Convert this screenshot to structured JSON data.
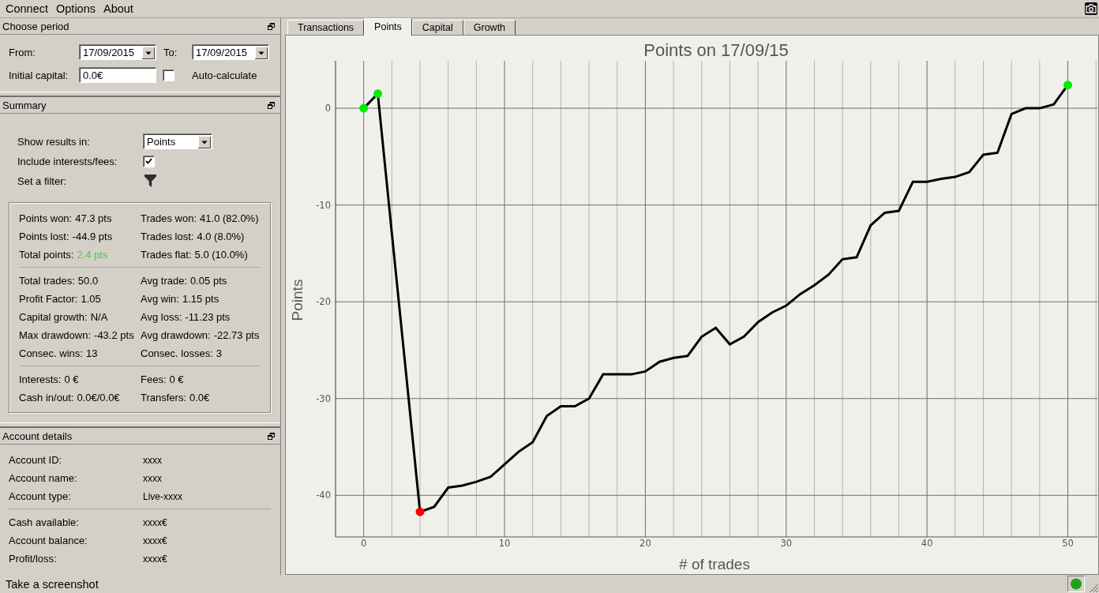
{
  "menu": [
    "Connect",
    "Options",
    "About"
  ],
  "choose_period": {
    "title": "Choose period",
    "from": {
      "label": "From:",
      "value": "17/09/2015"
    },
    "to": {
      "label": "To:",
      "value": "17/09/2015"
    },
    "initial_capital": {
      "label": "Initial capital:",
      "value": "0.0€"
    },
    "auto_calculate": {
      "label": "Auto-calculate",
      "checked": false
    }
  },
  "summary": {
    "title": "Summary",
    "show_results_in": {
      "label": "Show results in:",
      "value": "Points"
    },
    "include_interests_fees": {
      "label": "Include interests/fees:",
      "checked": true
    },
    "filter": {
      "label": "Set a filter:"
    },
    "stat_groups": [
      [
        {
          "label": "Points won:",
          "value": "47.3 pts"
        },
        {
          "label": "Trades won:",
          "value": "41.0 (82.0%)"
        },
        {
          "label": "Points lost:",
          "value": "-44.9 pts"
        },
        {
          "label": "Trades lost:",
          "value": "4.0 (8.0%)"
        },
        {
          "label": "Total points:",
          "value": "2.4 pts",
          "color": "#4ec94e"
        },
        {
          "label": "Trades flat:",
          "value": "5.0 (10.0%)"
        }
      ],
      [
        {
          "label": "Total trades:",
          "value": "50.0"
        },
        {
          "label": "Avg trade:",
          "value": "0.05 pts"
        },
        {
          "label": "Profit Factor:",
          "value": "1.05"
        },
        {
          "label": "Avg win:",
          "value": "1.15 pts"
        },
        {
          "label": "Capital growth:",
          "value": "N/A"
        },
        {
          "label": "Avg loss:",
          "value": "-11.23 pts"
        },
        {
          "label": "Max drawdown:",
          "value": "-43.2 pts"
        },
        {
          "label": "Avg drawdown:",
          "value": "-22.73 pts"
        },
        {
          "label": "Consec. wins:",
          "value": "13"
        },
        {
          "label": "Consec. losses:",
          "value": "3"
        }
      ],
      [
        {
          "label": "Interests:",
          "value": "0 €"
        },
        {
          "label": "Fees:",
          "value": "0 €"
        },
        {
          "label": "Cash in/out:",
          "value": "0.0€/0.0€"
        },
        {
          "label": "Transfers:",
          "value": "0.0€"
        }
      ]
    ]
  },
  "account_details": {
    "title": "Account details",
    "groups": [
      [
        {
          "label": "Account ID:",
          "value": "xxxx"
        },
        {
          "label": "Account name:",
          "value": "xxxx"
        },
        {
          "label": "Account type:",
          "value": "Live-xxxx"
        }
      ],
      [
        {
          "label": "Cash available:",
          "value": "xxxx€"
        },
        {
          "label": "Account balance:",
          "value": "xxxx€"
        },
        {
          "label": "Profit/loss:",
          "value": "xxxx€"
        }
      ]
    ]
  },
  "tabs": [
    {
      "label": "Transactions",
      "selected": false
    },
    {
      "label": "Points",
      "selected": true
    },
    {
      "label": "Capital",
      "selected": false
    },
    {
      "label": "Growth",
      "selected": false
    }
  ],
  "chart_panel": {
    "chart_data": {
      "type": "line",
      "title": "Points on 17/09/15",
      "xlabel": "# of trades",
      "ylabel": "Points",
      "x": [
        0,
        1,
        2,
        3,
        4,
        5,
        6,
        7,
        8,
        9,
        10,
        11,
        12,
        13,
        14,
        15,
        16,
        17,
        18,
        19,
        20,
        21,
        22,
        23,
        24,
        25,
        26,
        27,
        28,
        29,
        30,
        31,
        32,
        33,
        34,
        35,
        36,
        37,
        38,
        39,
        40,
        41,
        42,
        43,
        44,
        45,
        46,
        47,
        48,
        49,
        50
      ],
      "series": [
        {
          "color": "#000000",
          "values": [
            0,
            1.5,
            -12.9,
            -27.3,
            -41.7,
            -41.2,
            -39.2,
            -39.0,
            -38.6,
            -38.1,
            -36.8,
            -35.5,
            -34.5,
            -31.8,
            -30.8,
            -30.8,
            -30.0,
            -27.5,
            -27.5,
            -27.5,
            -27.2,
            -26.2,
            -25.8,
            -25.6,
            -23.6,
            -22.7,
            -24.4,
            -23.6,
            -22.1,
            -21.1,
            -20.4,
            -19.2,
            -18.3,
            -17.2,
            -15.6,
            -15.4,
            -12.1,
            -10.8,
            -10.6,
            -7.6,
            -7.6,
            -7.3,
            -7.1,
            -6.6,
            -4.8,
            -4.6,
            -0.6,
            0,
            0,
            0.4,
            2.4
          ]
        }
      ],
      "xlim": [
        -2,
        52.1
      ],
      "ylim": [
        -44.3,
        4.9
      ],
      "xticks": [
        0,
        10,
        20,
        30,
        40,
        50
      ],
      "yticks": [
        0,
        -10,
        -20,
        -30,
        -40
      ],
      "grid": true
    }
  },
  "status_bar": {
    "message": "Take a screenshot",
    "connected": true
  }
}
